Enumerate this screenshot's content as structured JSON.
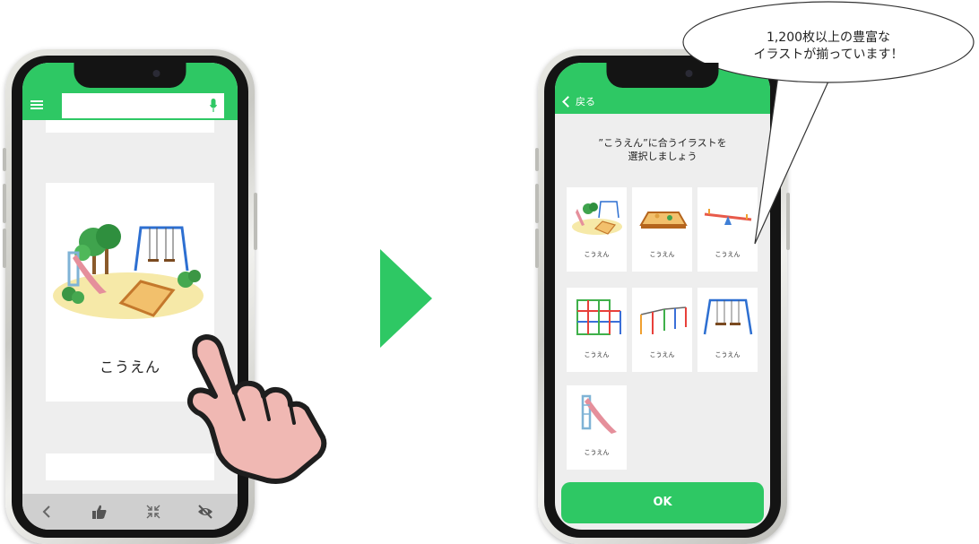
{
  "left_phone": {
    "card_label": "こうえん",
    "search": {
      "placeholder": ""
    },
    "bottom_bar": {
      "icons": [
        "back-icon",
        "thumbs-up-icon",
        "shrink-icon",
        "hide-icon"
      ]
    }
  },
  "right_phone": {
    "header": {
      "back_label": "戻る"
    },
    "instruction": {
      "line1": "”こうえん”に合うイラストを",
      "line2": "選択しましょう"
    },
    "illustrations": [
      {
        "label": "こうえん",
        "icon": "park-icon"
      },
      {
        "label": "こうえん",
        "icon": "sandbox-icon"
      },
      {
        "label": "こうえん",
        "icon": "seesaw-icon"
      },
      {
        "label": "こうえん",
        "icon": "jungle-gym-icon"
      },
      {
        "label": "こうえん",
        "icon": "horizontal-bars-icon"
      },
      {
        "label": "こうえん",
        "icon": "swing-icon"
      },
      {
        "label": "こうえん",
        "icon": "slide-icon"
      }
    ],
    "ok_label": "OK"
  },
  "callout": {
    "line1": "1,200枚以上の豊富な",
    "line2": "イラストが揃っています！"
  },
  "colors": {
    "accent": "#2ec864",
    "background": "#eeeeee",
    "card": "#ffffff"
  }
}
